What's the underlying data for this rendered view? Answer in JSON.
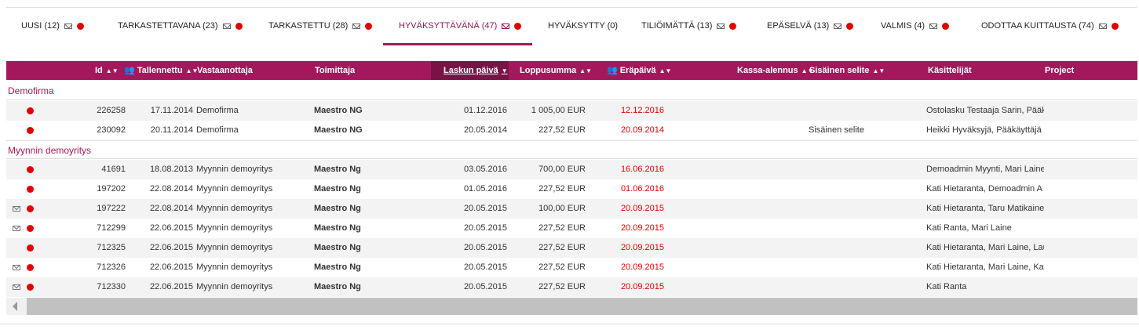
{
  "tabs": [
    {
      "label": "UUSI (12)",
      "mail": true,
      "dot": true
    },
    {
      "label": "TARKASTETTAVANA (23)",
      "mail": true,
      "dot": true
    },
    {
      "label": "TARKASTETTU (28)",
      "mail": true,
      "dot": true
    },
    {
      "label": "HYVÄKSYTTÄVÄNÄ (47)",
      "mail": true,
      "dot": true,
      "active": true
    },
    {
      "label": "HYVÄKSYTTY (0)",
      "mail": false,
      "dot": false
    },
    {
      "label": "TILIÖIMÄTTÄ (13)",
      "mail": true,
      "dot": true
    },
    {
      "label": "EPÄSELVÄ (13)",
      "mail": true,
      "dot": true
    },
    {
      "label": "VALMIS (4)",
      "mail": true,
      "dot": true
    },
    {
      "label": "ODOTTAA KUITTAUSTA (74)",
      "mail": true,
      "dot": true
    }
  ],
  "columns": {
    "id": "Id",
    "saved": "Tallennettu",
    "recipient": "Vastaanottaja",
    "supplier": "Toimittaja",
    "invoice_date": "Laskun päivä",
    "total": "Loppusumma",
    "due_date": "Eräpäivä",
    "cash_discount": "Kassa-alennus",
    "internal_note": "Sisäinen selite",
    "handlers": "Käsittelijät",
    "project": "Project"
  },
  "groups": [
    {
      "name": "Demofirma",
      "rows": [
        {
          "mail": false,
          "id": "226258",
          "saved": "17.11.2014",
          "recipient": "Demofirma",
          "supplier": "Maestro NG",
          "invoice_date": "01.12.2016",
          "total": "1 005,00 EUR",
          "due_date": "12.12.2016",
          "internal_note": "",
          "handlers": "Ostolasku Testaaja Sarin, Pääkä"
        },
        {
          "mail": false,
          "id": "230092",
          "saved": "20.11.2014",
          "recipient": "Demofirma",
          "supplier": "Maestro NG",
          "invoice_date": "20.05.2014",
          "total": "227,52 EUR",
          "due_date": "20.09.2014",
          "internal_note": "Sisäinen selite",
          "handlers": "Heikki Hyväksyjä, Pääkäyttäjä D"
        }
      ]
    },
    {
      "name": "Myynnin demoyritys",
      "rows": [
        {
          "mail": false,
          "id": "41691",
          "saved": "18.08.2013",
          "recipient": "Myynnin demoyritys",
          "supplier": "Maestro Ng",
          "invoice_date": "03.05.2016",
          "total": "700,00 EUR",
          "due_date": "16.06.2016",
          "internal_note": "",
          "handlers": "Demoadmin Myynti, Mari Laine"
        },
        {
          "mail": false,
          "id": "197202",
          "saved": "22.08.2014",
          "recipient": "Myynnin demoyritys",
          "supplier": "Maestro Ng",
          "invoice_date": "01.05.2016",
          "total": "227,52 EUR",
          "due_date": "01.06.2016",
          "internal_note": "",
          "handlers": "Kati Hietaranta, Demoadmin A"
        },
        {
          "mail": true,
          "id": "197222",
          "saved": "22.08.2014",
          "recipient": "Myynnin demoyritys",
          "supplier": "Maestro Ng",
          "invoice_date": "20.05.2015",
          "total": "100,00 EUR",
          "due_date": "20.09.2015",
          "internal_note": "",
          "handlers": "Kati Hietaranta, Taru Matikaine"
        },
        {
          "mail": true,
          "id": "712299",
          "saved": "22.06.2015",
          "recipient": "Myynnin demoyritys",
          "supplier": "Maestro Ng",
          "invoice_date": "20.05.2015",
          "total": "227,52 EUR",
          "due_date": "20.09.2015",
          "internal_note": "",
          "handlers": "Kati Ranta, Mari Laine"
        },
        {
          "mail": false,
          "id": "712325",
          "saved": "22.06.2015",
          "recipient": "Myynnin demoyritys",
          "supplier": "Maestro Ng",
          "invoice_date": "20.05.2015",
          "total": "227,52 EUR",
          "due_date": "20.09.2015",
          "internal_note": "",
          "handlers": "Kati Hietaranta, Mari Laine, Lau"
        },
        {
          "mail": true,
          "id": "712326",
          "saved": "22.06.2015",
          "recipient": "Myynnin demoyritys",
          "supplier": "Maestro Ng",
          "invoice_date": "20.05.2015",
          "total": "227,52 EUR",
          "due_date": "20.09.2015",
          "internal_note": "",
          "handlers": "Kati Hietaranta, Mari Laine, Kat"
        },
        {
          "mail": true,
          "id": "712330",
          "saved": "22.06.2015",
          "recipient": "Myynnin demoyritys",
          "supplier": "Maestro Ng",
          "invoice_date": "20.05.2015",
          "total": "227,52 EUR",
          "due_date": "20.09.2015",
          "internal_note": "",
          "handlers": "Kati Ranta"
        }
      ]
    }
  ],
  "colors": {
    "accent": "#a3185c",
    "active_sort": "#7a1345",
    "alert": "#e00000"
  }
}
